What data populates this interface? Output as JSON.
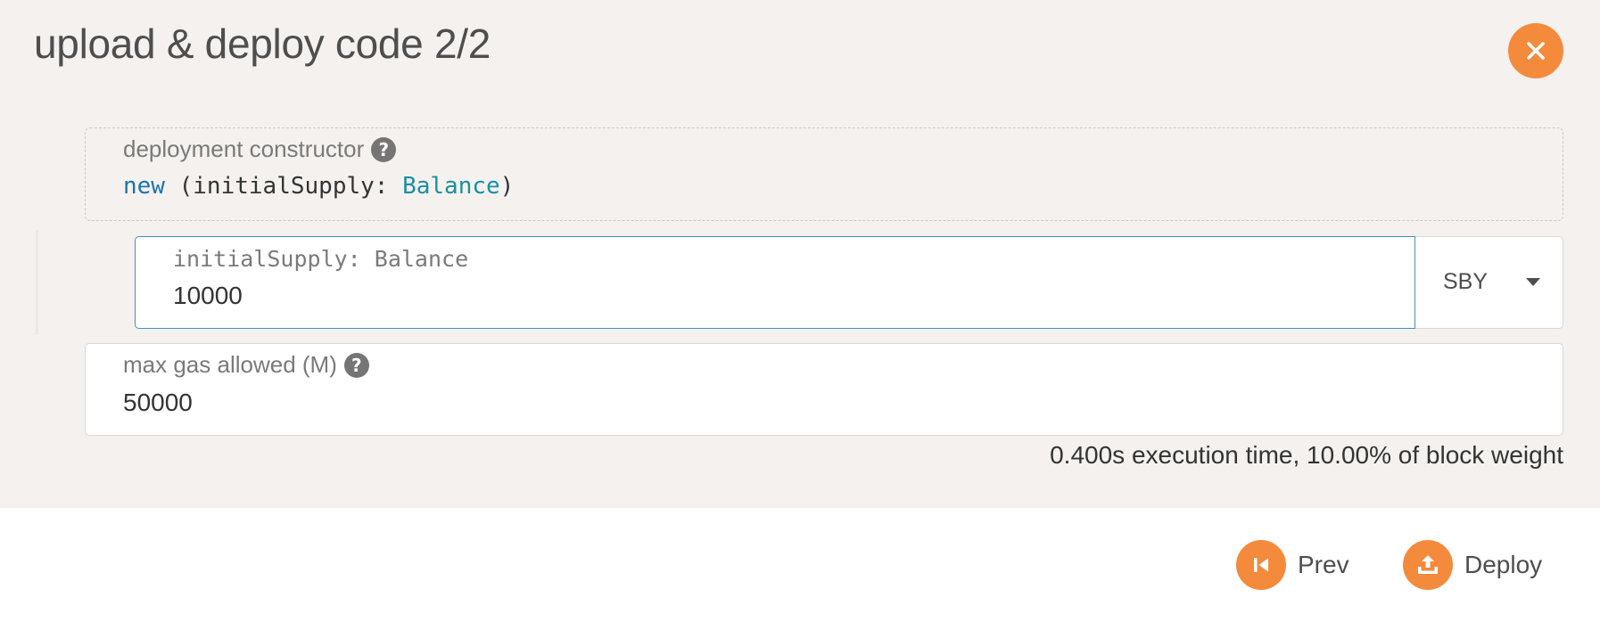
{
  "modal": {
    "title": "upload & deploy code 2/2",
    "close_icon": "close-icon",
    "accent_color": "#f48a3c"
  },
  "constructor": {
    "label": "deployment constructor",
    "help_icon": "help-icon",
    "help_glyph": "?",
    "code": {
      "keyword": "new",
      "open": " (",
      "param_name": "initialSupply: ",
      "param_type": "Balance",
      "close": ")"
    }
  },
  "params": [
    {
      "label": "initialSupply: Balance",
      "value": "10000",
      "unit": "SBY"
    }
  ],
  "gas": {
    "label": "max gas allowed (M)",
    "value": "50000",
    "help_glyph": "?"
  },
  "execution_info": "0.400s execution time, 10.00% of block weight",
  "actions": {
    "prev_label": "Prev",
    "deploy_label": "Deploy"
  }
}
